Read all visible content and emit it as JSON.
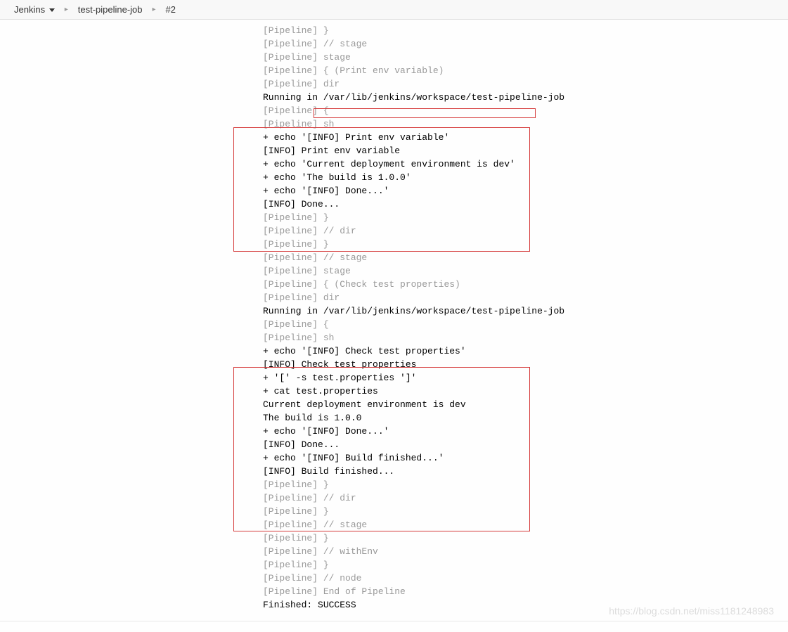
{
  "breadcrumb": {
    "root": "Jenkins",
    "job": "test-pipeline-job",
    "build": "#2"
  },
  "console": {
    "lines": [
      {
        "muted": true,
        "text": "[Pipeline] }"
      },
      {
        "muted": true,
        "text": "[Pipeline] // stage"
      },
      {
        "muted": true,
        "text": "[Pipeline] stage"
      },
      {
        "muted": true,
        "text": "[Pipeline] { (Print env variable)"
      },
      {
        "muted": true,
        "text": "[Pipeline] dir"
      },
      {
        "muted": false,
        "text": "Running in /var/lib/jenkins/workspace/test-pipeline-job"
      },
      {
        "muted": true,
        "text": "[Pipeline] {"
      },
      {
        "muted": true,
        "text": "[Pipeline] sh"
      },
      {
        "muted": false,
        "text": "+ echo '[INFO] Print env variable'"
      },
      {
        "muted": false,
        "text": "[INFO] Print env variable"
      },
      {
        "muted": false,
        "text": "+ echo 'Current deployment environment is dev'"
      },
      {
        "muted": false,
        "text": "+ echo 'The build is 1.0.0'"
      },
      {
        "muted": false,
        "text": "+ echo '[INFO] Done...'"
      },
      {
        "muted": false,
        "text": "[INFO] Done..."
      },
      {
        "muted": true,
        "text": "[Pipeline] }"
      },
      {
        "muted": true,
        "text": "[Pipeline] // dir"
      },
      {
        "muted": true,
        "text": "[Pipeline] }"
      },
      {
        "muted": true,
        "text": "[Pipeline] // stage"
      },
      {
        "muted": true,
        "text": "[Pipeline] stage"
      },
      {
        "muted": true,
        "text": "[Pipeline] { (Check test properties)"
      },
      {
        "muted": true,
        "text": "[Pipeline] dir"
      },
      {
        "muted": false,
        "text": "Running in /var/lib/jenkins/workspace/test-pipeline-job"
      },
      {
        "muted": true,
        "text": "[Pipeline] {"
      },
      {
        "muted": true,
        "text": "[Pipeline] sh"
      },
      {
        "muted": false,
        "text": "+ echo '[INFO] Check test properties'"
      },
      {
        "muted": false,
        "text": "[INFO] Check test properties"
      },
      {
        "muted": false,
        "text": "+ '[' -s test.properties ']'"
      },
      {
        "muted": false,
        "text": "+ cat test.properties"
      },
      {
        "muted": false,
        "text": "Current deployment environment is dev"
      },
      {
        "muted": false,
        "text": "The build is 1.0.0"
      },
      {
        "muted": false,
        "text": "+ echo '[INFO] Done...'"
      },
      {
        "muted": false,
        "text": "[INFO] Done..."
      },
      {
        "muted": false,
        "text": "+ echo '[INFO] Build finished...'"
      },
      {
        "muted": false,
        "text": "[INFO] Build finished..."
      },
      {
        "muted": true,
        "text": "[Pipeline] }"
      },
      {
        "muted": true,
        "text": "[Pipeline] // dir"
      },
      {
        "muted": true,
        "text": "[Pipeline] }"
      },
      {
        "muted": true,
        "text": "[Pipeline] // stage"
      },
      {
        "muted": true,
        "text": "[Pipeline] }"
      },
      {
        "muted": true,
        "text": "[Pipeline] // withEnv"
      },
      {
        "muted": true,
        "text": "[Pipeline] }"
      },
      {
        "muted": true,
        "text": "[Pipeline] // node"
      },
      {
        "muted": true,
        "text": "[Pipeline] End of Pipeline"
      },
      {
        "muted": false,
        "text": "Finished: SUCCESS"
      }
    ]
  },
  "watermark": "https://blog.csdn.net/miss1181248983"
}
